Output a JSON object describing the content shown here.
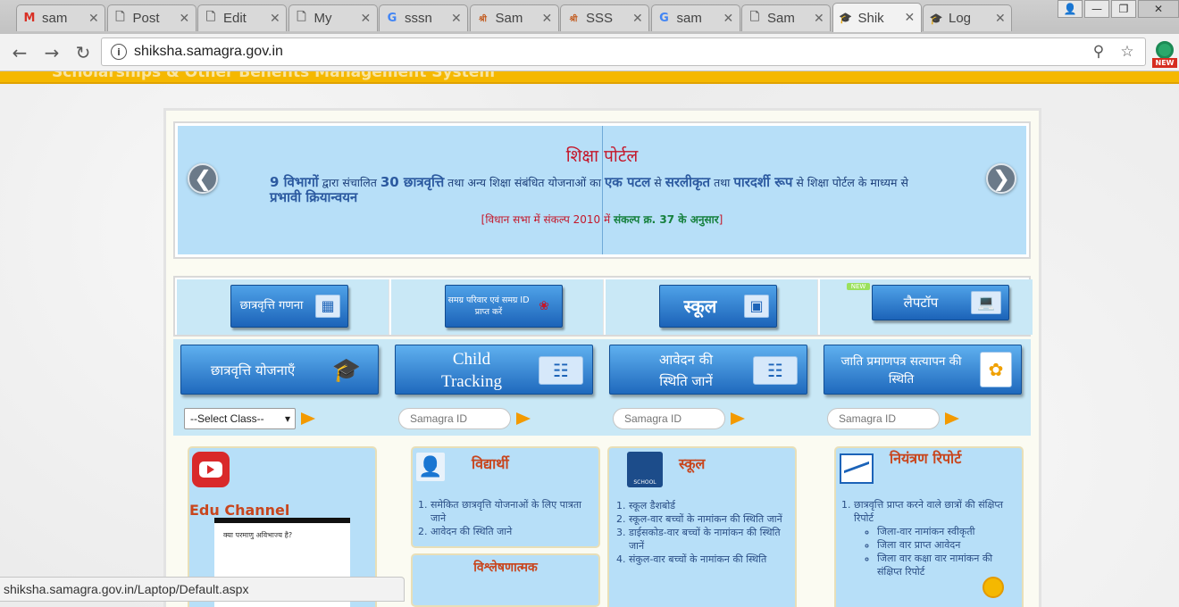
{
  "browser": {
    "tabs": [
      {
        "title": "sam",
        "icon": "M",
        "icon_color": "#d93025"
      },
      {
        "title": "Post",
        "icon": "doc",
        "icon_color": "#666666"
      },
      {
        "title": "Edit",
        "icon": "doc",
        "icon_color": "#666666"
      },
      {
        "title": "My",
        "icon": "doc",
        "icon_color": "#666666"
      },
      {
        "title": "sssn",
        "icon": "G",
        "icon_color": "#4285f4"
      },
      {
        "title": "Sam",
        "icon": "श्री",
        "icon_color": "#c25a1d"
      },
      {
        "title": "SSS",
        "icon": "श्री",
        "icon_color": "#c25a1d"
      },
      {
        "title": "sam",
        "icon": "G",
        "icon_color": "#4285f4"
      },
      {
        "title": "Sam",
        "icon": "doc",
        "icon_color": "#666666"
      },
      {
        "title": "Shik",
        "icon": "cap",
        "icon_color": "#333333",
        "active": true
      },
      {
        "title": "Log",
        "icon": "cap",
        "icon_color": "#8b0000"
      }
    ],
    "url": "shiksha.samagra.gov.in",
    "status_url": "shiksha.samagra.gov.in/Laptop/Default.aspx",
    "extension_badge": "NEW"
  },
  "banner": {
    "title": "शिक्षा पोर्टल",
    "desc_1": "9 विभागों",
    "desc_2": " द्वारा संचालित ",
    "desc_3": "30 छात्रवृत्ति",
    "desc_4": " तथा अन्य शिक्षा संबंधित योजनाओं का ",
    "desc_5": "एक पटल",
    "desc_6": " से ",
    "desc_7": "सरलीकृत",
    "desc_8": " तथा ",
    "desc_9": "पारदर्शी रूप",
    "desc_10": " से शिक्षा पोर्टल के माध्यम से ",
    "desc_11": "प्रभावी क्रियान्वयन",
    "note_1": "[विधान सभा में संकल्प 2010 में ",
    "note_2": "संकल्प क्र. 37 के अनुसार",
    "note_3": "]",
    "prev": "❮",
    "next": "❯"
  },
  "quick_buttons": [
    {
      "label": "छात्रवृत्ति गणना",
      "icon": "grid-icon"
    },
    {
      "label": "समग्र परिवार एवं समग्र ID प्राप्त करें",
      "icon": "samagra-logo-icon"
    },
    {
      "label": "स्कूल",
      "icon": "school-icon"
    },
    {
      "label": "लैपटॉप",
      "icon": "laptop-icon",
      "tag": "NEW"
    }
  ],
  "main_buttons": [
    {
      "label": "छात्रवृत्ति योजनाएँ",
      "icon": "graduation-cap-icon"
    },
    {
      "label": "Child Tracking",
      "icon": "id-card-icon"
    },
    {
      "label": "आवेदन की स्थिति जानें",
      "icon": "id-card-icon"
    },
    {
      "label": "जाति प्रमाणपत्र सत्यापन की स्थिति",
      "icon": "certificate-icon"
    }
  ],
  "inputs": {
    "class_select": "--Select Class--",
    "samagra_placeholder": "Samagra ID"
  },
  "panels": {
    "edu": {
      "title": "Edu Channel",
      "video_text": "क्या परमाणु अविभाज्य है?"
    },
    "student": {
      "title": "विद्यार्थी",
      "items": [
        "समेकित छात्रवृत्ति योजनाओं के लिए पात्रता जाने",
        "आवेदन की स्थिति जाने"
      ]
    },
    "analysis": {
      "title": "विश्लेषणात्मक"
    },
    "school": {
      "title": "स्कूल",
      "icon_label": "SCHOOL",
      "items": [
        "स्कूल डैशबोर्ड",
        "स्कूल-वार बच्चों के नामांकन की स्थिति जानें",
        "डाईसकोड-वार बच्चों के नामांकन की स्थिति जानें",
        "संकुल-वार बच्चों के नामांकन की स्थिति"
      ]
    },
    "report": {
      "title": "नियंत्रण रिपोर्ट",
      "item": "छात्रवृत्ति प्राप्त करने वाले छात्रों की संक्षिप्त रिपोर्ट",
      "subitems": [
        "जिला-वार नामांकन स्वीकृती",
        "जिला वार प्राप्त आवेदन",
        "जिला वार कक्षा वार नामांकन की संक्षिप्त रिपोर्ट"
      ]
    }
  }
}
